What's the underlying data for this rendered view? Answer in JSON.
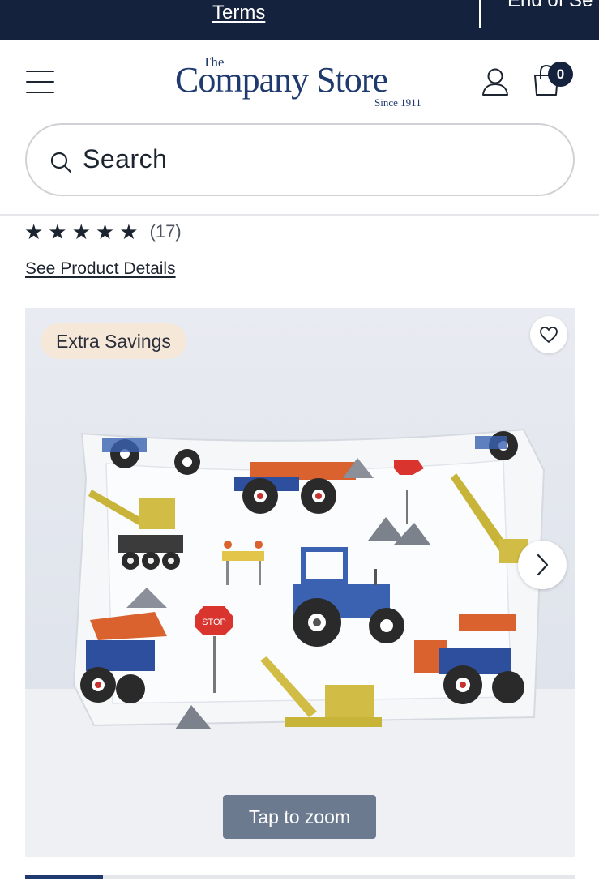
{
  "promo": {
    "terms_label": "Terms",
    "next_label": "End of Se"
  },
  "header": {
    "logo": {
      "the": "The",
      "name": "Company Store",
      "since": "Since 1911"
    },
    "menu_icon": "hamburger-menu-icon",
    "account_icon": "user-icon",
    "cart_icon": "shopping-bag-icon",
    "cart_count": "0"
  },
  "search": {
    "placeholder": "Search",
    "icon": "search-icon"
  },
  "product": {
    "rating": {
      "stars_text": "★★★★★",
      "stars_value": 5,
      "count": "(17)"
    },
    "details_link": "See Product Details",
    "image": {
      "badge": "Extra Savings",
      "wishlist_icon": "heart-icon",
      "next_icon": "chevron-right-icon",
      "zoom_label": "Tap to zoom",
      "sign_text": "STOP"
    },
    "pager": {
      "active_index": 1
    }
  },
  "colors": {
    "navy": "#14223d",
    "brand_blue": "#1f3a6e",
    "badge_bg": "#f6e8d8",
    "zoom_bg": "#6c7a8f"
  }
}
